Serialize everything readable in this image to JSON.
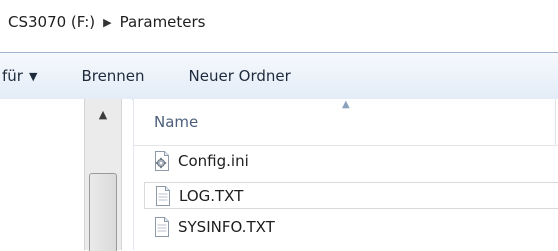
{
  "breadcrumb": {
    "drive": "CS3070 (F:)",
    "separator": "▶",
    "folder": "Parameters"
  },
  "toolbar": {
    "share_label": "für",
    "share_caret": "▼",
    "burn_label": "Brennen",
    "new_folder_label": "Neuer Ordner"
  },
  "file_list": {
    "column_name": "Name",
    "sort_indicator": "▲",
    "files": [
      {
        "name": "Config.ini",
        "icon": "config-settings-icon"
      },
      {
        "name": "LOG.TXT",
        "icon": "text-document-icon"
      },
      {
        "name": "SYSINFO.TXT",
        "icon": "text-document-icon"
      }
    ]
  },
  "scrollbar": {
    "up_arrow": "▲"
  }
}
